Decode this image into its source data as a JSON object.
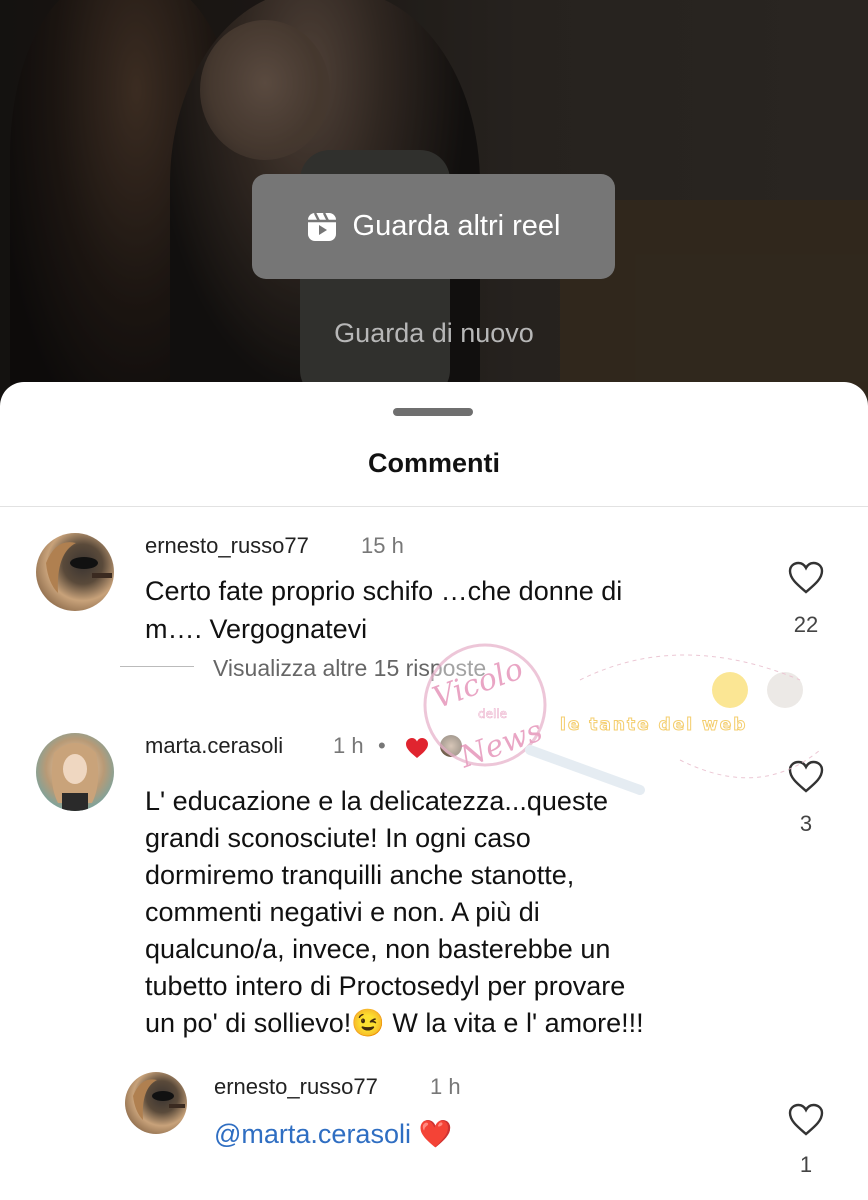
{
  "video": {
    "reel_button_label": "Guarda altri reel",
    "rewatch_label": "Guarda di nuovo"
  },
  "sheet": {
    "title": "Commenti"
  },
  "comments": [
    {
      "username": "ernesto_russo77",
      "time": "15 h",
      "text_line1": "Certo fate proprio schifo …che donne di",
      "text_line2": "m…. Vergognatevi",
      "likes": "22",
      "view_replies": "Visualizza altre 15 risposte"
    },
    {
      "username": "marta.cerasoli",
      "time": "1 h",
      "dot": "•",
      "lines": [
        "L' educazione e la delicatezza...queste",
        "grandi sconosciute! In ogni caso",
        "dormiremo tranquilli anche stanotte,",
        "commenti negativi e non. A più di",
        "qualcuno/a, invece, non basterebbe un",
        "tubetto intero di Proctosedyl per provare",
        "un po' di sollievo!😉 W la vita e l' amore!!!"
      ],
      "likes": "3"
    },
    {
      "username": "ernesto_russo77",
      "time": "1 h",
      "mention": "@marta.cerasoli",
      "emoji": "❤️",
      "likes": "1"
    }
  ],
  "watermark": {
    "logo_text_1": "Vicolo",
    "logo_text_2": "delle",
    "logo_text_3": "News",
    "banner_text": "le tante del web"
  },
  "colors": {
    "link": "#2f6ec2",
    "heart_red": "#e0242f"
  }
}
